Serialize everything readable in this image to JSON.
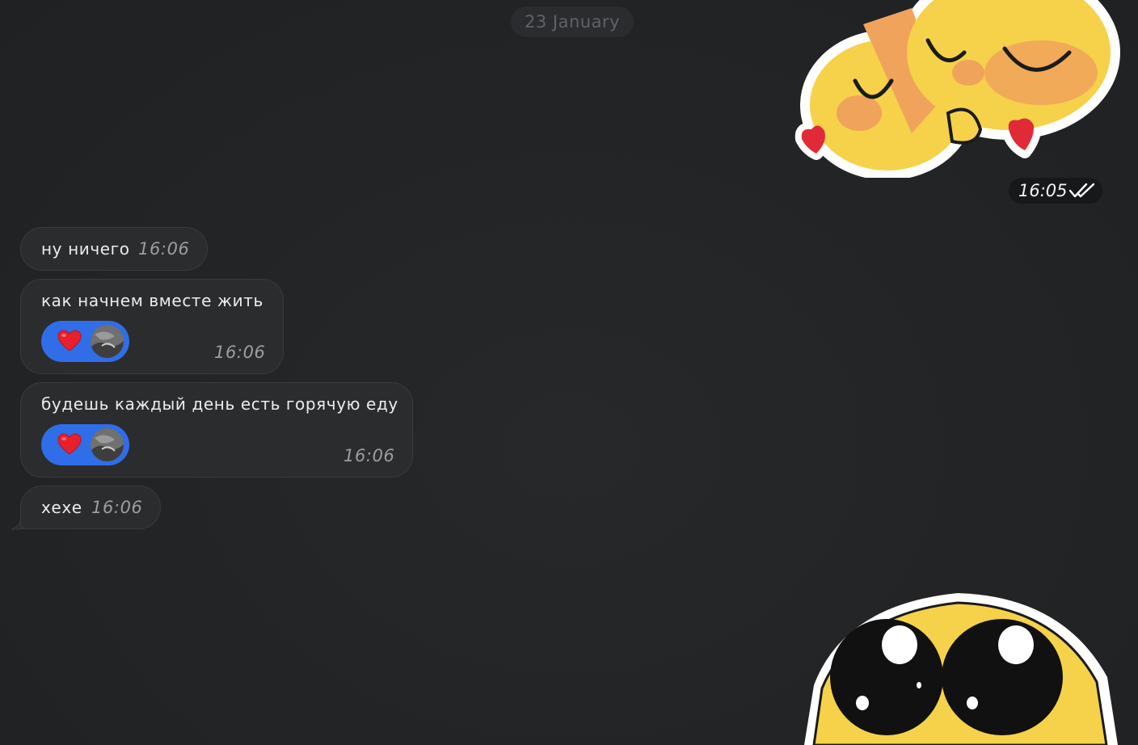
{
  "chat": {
    "date_separator": "23 January",
    "outgoing": {
      "sticker_top": "sticker-hugging-emojis",
      "time": "16:05",
      "status": "double-check-icon",
      "sticker_bottom": "sticker-pleading-face"
    },
    "messages": [
      {
        "text": "ну ничего",
        "time": "16:06"
      },
      {
        "text": "как начнем вместе жить",
        "time": "16:06",
        "reaction": "heart-icon"
      },
      {
        "text": "будешь каждый день есть горячую еду",
        "time": "16:06",
        "reaction": "heart-icon"
      },
      {
        "text": "хехе",
        "time": "16:06"
      }
    ]
  },
  "colors": {
    "background": "#212325",
    "bubble": "#2b2c2e",
    "reaction": "#2f6ee8",
    "heart": "#e8202c",
    "sticker_yellow": "#f5d24a",
    "sticker_orange": "#f0a35a"
  }
}
